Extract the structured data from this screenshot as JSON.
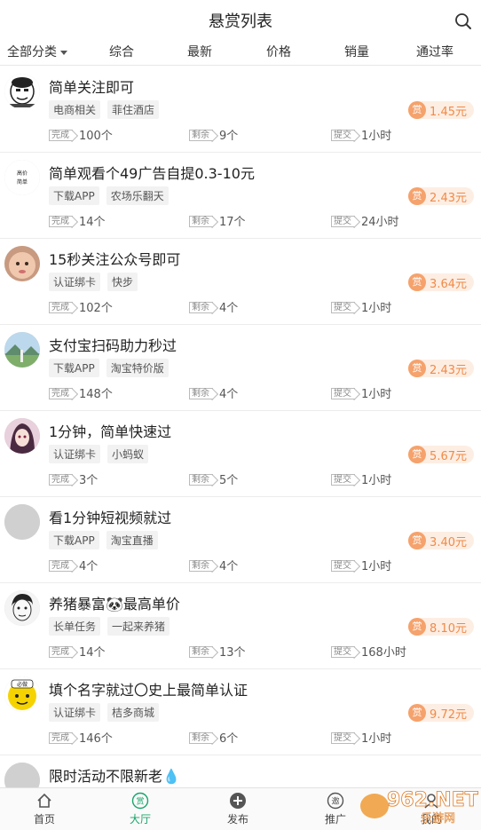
{
  "header": {
    "title": "悬赏列表",
    "search_icon": "search-icon"
  },
  "filters": [
    "全部分类",
    "综合",
    "最新",
    "价格",
    "销量",
    "通过率"
  ],
  "active_filter": 1,
  "stat_labels": {
    "done": "完成",
    "left": "剩余",
    "submit": "提交"
  },
  "reward_badge": "赏",
  "tasks": [
    {
      "title": "简单关注即可",
      "tags": [
        "电商相关",
        "菲住酒店"
      ],
      "done": "100个",
      "left": "9个",
      "submit": "1小时",
      "reward": "1.45元",
      "avatar": "meme-face"
    },
    {
      "title": "简单观看个49广告自提0.3-10元",
      "tags": [
        "下载APP",
        "农场乐翻天"
      ],
      "done": "14个",
      "left": "17个",
      "submit": "24小时",
      "reward": "2.43元",
      "avatar": "text-logo",
      "avatar_text": "高价\n简单"
    },
    {
      "title": "15秒关注公众号即可",
      "tags": [
        "认证绑卡",
        "快步"
      ],
      "done": "102个",
      "left": "4个",
      "submit": "1小时",
      "reward": "3.64元",
      "avatar": "baby"
    },
    {
      "title": "支付宝扫码助力秒过",
      "tags": [
        "下载APP",
        "淘宝特价版"
      ],
      "done": "148个",
      "left": "4个",
      "submit": "1小时",
      "reward": "2.43元",
      "avatar": "landscape"
    },
    {
      "title": "1分钟，简单快速过",
      "tags": [
        "认证绑卡",
        "小蚂蚁"
      ],
      "done": "3个",
      "left": "5个",
      "submit": "1小时",
      "reward": "5.67元",
      "avatar": "anime"
    },
    {
      "title": "看1分钟短视频就过",
      "tags": [
        "下载APP",
        "淘宝直播"
      ],
      "done": "4个",
      "left": "4个",
      "submit": "1小时",
      "reward": "3.40元",
      "avatar": "blank"
    },
    {
      "title": "养猪暴富🐼最高单价",
      "tags": [
        "长单任务",
        "一起来养猪"
      ],
      "done": "14个",
      "left": "13个",
      "submit": "168小时",
      "reward": "8.10元",
      "avatar": "sketch"
    },
    {
      "title": "填个名字就过〇史上最简单认证",
      "tags": [
        "认证绑卡",
        "桔多商城"
      ],
      "done": "146个",
      "left": "6个",
      "submit": "1小时",
      "reward": "9.72元",
      "avatar": "yellow-face",
      "avatar_text": "必做"
    },
    {
      "title": "限时活动不限新老💧",
      "tags": [],
      "done": "",
      "left": "",
      "submit": "",
      "reward": "",
      "avatar": "blank"
    }
  ],
  "tabbar": [
    {
      "label": "首页",
      "icon": "home-icon"
    },
    {
      "label": "大厅",
      "icon": "hall-icon",
      "glyph": "赏"
    },
    {
      "label": "发布",
      "icon": "publish-icon",
      "glyph": "+"
    },
    {
      "label": "推广",
      "icon": "promote-icon",
      "glyph": "邀"
    },
    {
      "label": "我的",
      "icon": "profile-icon"
    }
  ],
  "active_tab": 1,
  "watermark": {
    "brand": "962.NET",
    "sub": "乐游网"
  },
  "colors": {
    "accent": "#19a56b",
    "reward": "#f08a47",
    "reward_bg": "#fdeee3"
  }
}
